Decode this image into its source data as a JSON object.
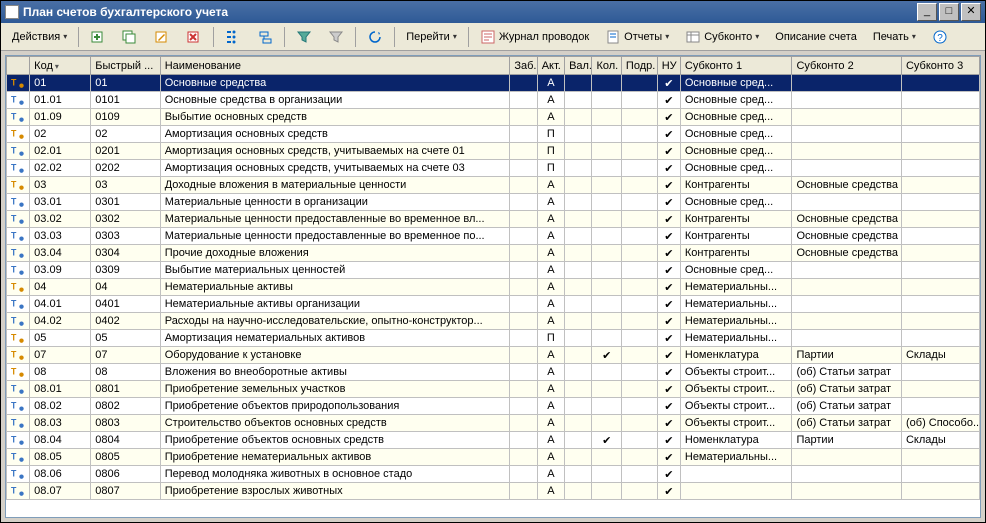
{
  "window": {
    "title": "План счетов бухгалтерского учета"
  },
  "toolbar": {
    "actions_label": "Действия",
    "go_label": "Перейти",
    "journal_label": "Журнал проводок",
    "reports_label": "Отчеты",
    "subkonto_label": "Субконто",
    "desc_label": "Описание счета",
    "print_label": "Печать"
  },
  "columns": {
    "c0": "",
    "c1": "Код",
    "c2": "Быстрый ...",
    "c3": "Наименование",
    "c4": "Заб.",
    "c5": "Акт.",
    "c6": "Вал.",
    "c7": "Кол.",
    "c8": "Подр.",
    "c9": "НУ",
    "c10": "Субконто 1",
    "c11": "Субконто 2",
    "c12": "Субконто 3"
  },
  "rows": [
    {
      "lvl": 1,
      "code": "01",
      "quick": "01",
      "name": "Основные средства",
      "act": "А",
      "nu": true,
      "s1": "Основные сред..."
    },
    {
      "lvl": 2,
      "code": "01.01",
      "quick": "0101",
      "name": "Основные средства в организации",
      "act": "А",
      "nu": true,
      "s1": "Основные сред..."
    },
    {
      "lvl": 2,
      "code": "01.09",
      "quick": "0109",
      "name": "Выбытие основных средств",
      "act": "А",
      "nu": true,
      "s1": "Основные сред..."
    },
    {
      "lvl": 1,
      "code": "02",
      "quick": "02",
      "name": "Амортизация основных средств",
      "act": "П",
      "nu": true,
      "s1": "Основные сред..."
    },
    {
      "lvl": 2,
      "code": "02.01",
      "quick": "0201",
      "name": "Амортизация основных средств, учитываемых на счете 01",
      "act": "П",
      "nu": true,
      "s1": "Основные сред..."
    },
    {
      "lvl": 2,
      "code": "02.02",
      "quick": "0202",
      "name": "Амортизация основных средств, учитываемых на счете 03",
      "act": "П",
      "nu": true,
      "s1": "Основные сред..."
    },
    {
      "lvl": 1,
      "code": "03",
      "quick": "03",
      "name": "Доходные вложения в материальные ценности",
      "act": "А",
      "nu": true,
      "s1": "Контрагенты",
      "s2": "Основные средства"
    },
    {
      "lvl": 2,
      "code": "03.01",
      "quick": "0301",
      "name": "Материальные ценности в организации",
      "act": "А",
      "nu": true,
      "s1": "Основные сред..."
    },
    {
      "lvl": 2,
      "code": "03.02",
      "quick": "0302",
      "name": "Материальные ценности предоставленные во временное вл...",
      "act": "А",
      "nu": true,
      "s1": "Контрагенты",
      "s2": "Основные средства"
    },
    {
      "lvl": 2,
      "code": "03.03",
      "quick": "0303",
      "name": "Материальные ценности предоставленные во временное по...",
      "act": "А",
      "nu": true,
      "s1": "Контрагенты",
      "s2": "Основные средства"
    },
    {
      "lvl": 2,
      "code": "03.04",
      "quick": "0304",
      "name": "Прочие доходные вложения",
      "act": "А",
      "nu": true,
      "s1": "Контрагенты",
      "s2": "Основные средства"
    },
    {
      "lvl": 2,
      "code": "03.09",
      "quick": "0309",
      "name": "Выбытие материальных ценностей",
      "act": "А",
      "nu": true,
      "s1": "Основные сред..."
    },
    {
      "lvl": 1,
      "code": "04",
      "quick": "04",
      "name": "Нематериальные активы",
      "act": "А",
      "nu": true,
      "s1": "Нематериальны..."
    },
    {
      "lvl": 2,
      "code": "04.01",
      "quick": "0401",
      "name": "Нематериальные активы организации",
      "act": "А",
      "nu": true,
      "s1": "Нематериальны..."
    },
    {
      "lvl": 2,
      "code": "04.02",
      "quick": "0402",
      "name": "Расходы на научно-исследовательские, опытно-конструктор...",
      "act": "А",
      "nu": true,
      "s1": "Нематериальны..."
    },
    {
      "lvl": 1,
      "code": "05",
      "quick": "05",
      "name": "Амортизация нематериальных активов",
      "act": "П",
      "nu": true,
      "s1": "Нематериальны..."
    },
    {
      "lvl": 1,
      "code": "07",
      "quick": "07",
      "name": "Оборудование к установке",
      "act": "А",
      "kol": true,
      "nu": true,
      "s1": "Номенклатура",
      "s2": "Партии",
      "s3": "Склады"
    },
    {
      "lvl": 1,
      "code": "08",
      "quick": "08",
      "name": "Вложения во внеоборотные активы",
      "act": "А",
      "nu": true,
      "s1": "Объекты строит...",
      "s2": "(об) Статьи затрат"
    },
    {
      "lvl": 2,
      "code": "08.01",
      "quick": "0801",
      "name": "Приобретение земельных участков",
      "act": "А",
      "nu": true,
      "s1": "Объекты строит...",
      "s2": "(об) Статьи затрат"
    },
    {
      "lvl": 2,
      "code": "08.02",
      "quick": "0802",
      "name": "Приобретение объектов природопользования",
      "act": "А",
      "nu": true,
      "s1": "Объекты строит...",
      "s2": "(об) Статьи затрат"
    },
    {
      "lvl": 2,
      "code": "08.03",
      "quick": "0803",
      "name": "Строительство объектов основных средств",
      "act": "А",
      "nu": true,
      "s1": "Объекты строит...",
      "s2": "(об) Статьи затрат",
      "s3": "(об) Способо..."
    },
    {
      "lvl": 2,
      "code": "08.04",
      "quick": "0804",
      "name": "Приобретение объектов основных средств",
      "act": "А",
      "kol": true,
      "nu": true,
      "s1": "Номенклатура",
      "s2": "Партии",
      "s3": "Склады"
    },
    {
      "lvl": 2,
      "code": "08.05",
      "quick": "0805",
      "name": "Приобретение нематериальных активов",
      "act": "А",
      "nu": true,
      "s1": "Нематериальны..."
    },
    {
      "lvl": 2,
      "code": "08.06",
      "quick": "0806",
      "name": "Перевод молодняка животных в основное стадо",
      "act": "А",
      "nu": true
    },
    {
      "lvl": 2,
      "code": "08.07",
      "quick": "0807",
      "name": "Приобретение взрослых животных",
      "act": "А",
      "nu": true
    }
  ]
}
